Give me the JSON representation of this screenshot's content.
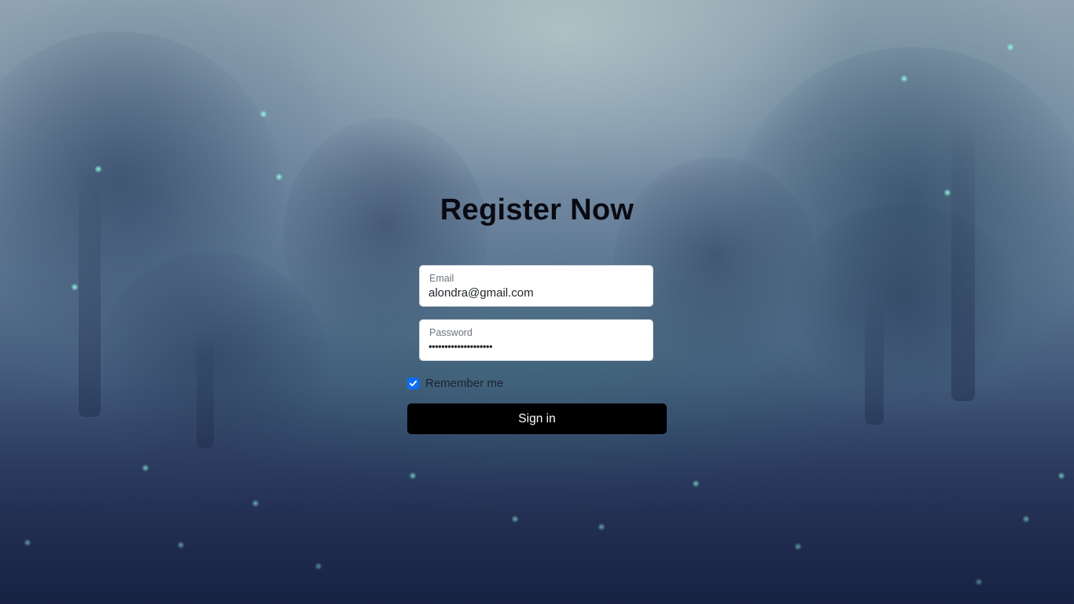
{
  "form": {
    "title": "Register Now",
    "email": {
      "label": "Email",
      "value": "alondra@gmail.com"
    },
    "password": {
      "label": "Password",
      "value": "••••••••••••••••••••"
    },
    "remember": {
      "label": "Remember me",
      "checked": true
    },
    "submit_label": "Sign in"
  },
  "colors": {
    "button_bg": "#000000",
    "checkbox_accent": "#0d6efd"
  },
  "icons": {
    "checkbox": "checkmark-icon"
  }
}
